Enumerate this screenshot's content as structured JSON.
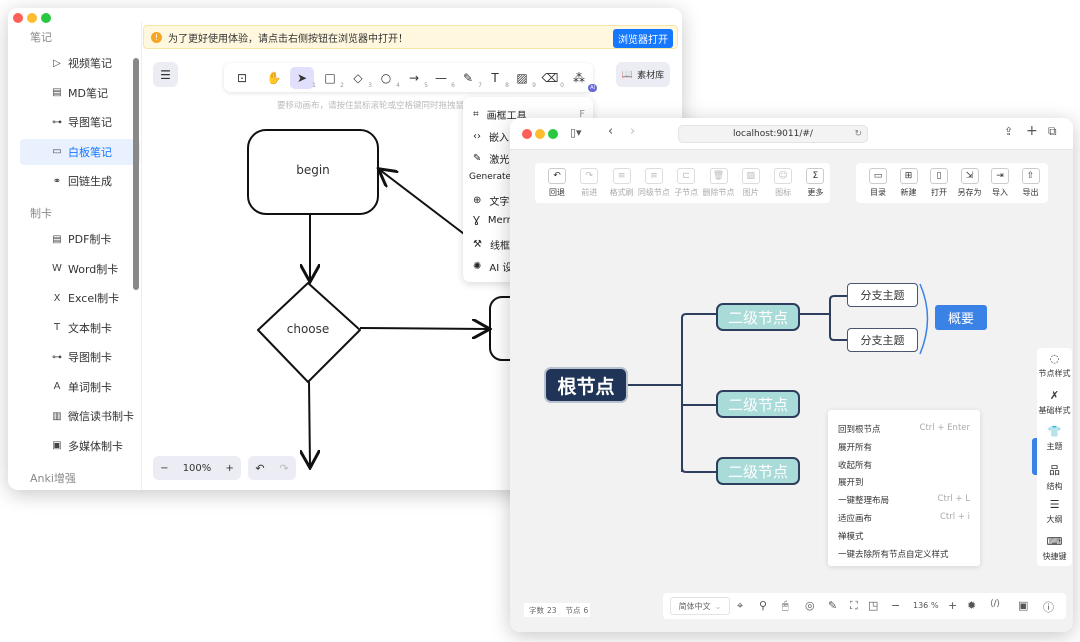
{
  "back_window": {
    "sidebar": {
      "sections": [
        {
          "title": "笔记",
          "items": [
            {
              "label": "视频笔记",
              "icon": "play-circle-icon"
            },
            {
              "label": "MD笔记",
              "icon": "markdown-file-icon"
            },
            {
              "label": "导图笔记",
              "icon": "mindmap-icon"
            },
            {
              "label": "白板笔记",
              "icon": "whiteboard-icon",
              "active": true
            },
            {
              "label": "回链生成",
              "icon": "link-icon"
            }
          ]
        },
        {
          "title": "制卡",
          "items": [
            {
              "label": "PDF制卡",
              "icon": "pdf-icon"
            },
            {
              "label": "Word制卡",
              "icon": "word-icon"
            },
            {
              "label": "Excel制卡",
              "icon": "excel-icon"
            },
            {
              "label": "文本制卡",
              "icon": "text-icon"
            },
            {
              "label": "导图制卡",
              "icon": "mindmap-icon"
            },
            {
              "label": "单词制卡",
              "icon": "letter-a-icon"
            },
            {
              "label": "微信读书制卡",
              "icon": "book-icon"
            },
            {
              "label": "多媒体制卡",
              "icon": "media-icon"
            }
          ]
        },
        {
          "title": "Anki增强",
          "items": []
        }
      ]
    },
    "banner": {
      "text": "为了更好使用体验，请点击右侧按钮在浏览器中打开！",
      "button": "浏览器打开"
    },
    "toolbar": {
      "tools": [
        {
          "icon": "lock-icon",
          "key": ""
        },
        {
          "icon": "hand-icon",
          "key": ""
        },
        {
          "icon": "pointer-icon",
          "key": "1",
          "active": true
        },
        {
          "icon": "rectangle-icon",
          "key": "2"
        },
        {
          "icon": "diamond-icon",
          "key": "3"
        },
        {
          "icon": "circle-icon",
          "key": "4"
        },
        {
          "icon": "arrow-icon",
          "key": "5"
        },
        {
          "icon": "line-icon",
          "key": "6"
        },
        {
          "icon": "pencil-icon",
          "key": "7"
        },
        {
          "icon": "text-icon",
          "key": "8"
        },
        {
          "icon": "image-icon",
          "key": "9"
        },
        {
          "icon": "eraser-icon",
          "key": "0"
        },
        {
          "icon": "shapes-icon",
          "key": "",
          "badge": "AI"
        }
      ],
      "library": "素材库",
      "hint": "要移动画布，请按住鼠标滚轮或空格键同时拖拽鼠标"
    },
    "dropdown": {
      "items": [
        {
          "label": "画框工具",
          "shortcut": "F",
          "icon": "frame-icon"
        },
        {
          "label": "嵌入",
          "icon": "embed-icon"
        },
        {
          "label": "激光",
          "icon": "laser-icon"
        }
      ],
      "section": "Generate",
      "gen_items": [
        {
          "label": "文字",
          "icon": "brain-icon"
        },
        {
          "label": "Merm",
          "icon": "mermaid-icon"
        },
        {
          "label": "线框",
          "icon": "wand-icon"
        },
        {
          "label": "AI 设",
          "icon": "openai-icon"
        }
      ]
    },
    "canvas": {
      "shapes": {
        "begin": "begin",
        "choose": "choose"
      }
    },
    "zoom": {
      "value": "100%",
      "minus": "−",
      "plus": "+"
    }
  },
  "front_window": {
    "url": "localhost:9011/#/",
    "toolbar_left": [
      {
        "label": "回退",
        "icon": "undo-icon",
        "enabled": true
      },
      {
        "label": "前进",
        "icon": "redo-icon"
      },
      {
        "label": "格式刷",
        "icon": "format-brush-icon"
      },
      {
        "label": "同级节点",
        "icon": "sibling-node-icon"
      },
      {
        "label": "子节点",
        "icon": "child-node-icon"
      },
      {
        "label": "删除节点",
        "icon": "trash-icon"
      },
      {
        "label": "图片",
        "icon": "image-icon"
      },
      {
        "label": "图标",
        "icon": "smiley-icon"
      },
      {
        "label": "更多",
        "icon": "formula-icon",
        "enabled": true
      }
    ],
    "toolbar_right": [
      {
        "label": "目录",
        "icon": "folder-icon"
      },
      {
        "label": "新建",
        "icon": "new-file-icon"
      },
      {
        "label": "打开",
        "icon": "file-icon"
      },
      {
        "label": "另存为",
        "icon": "save-as-icon"
      },
      {
        "label": "导入",
        "icon": "import-icon"
      },
      {
        "label": "导出",
        "icon": "export-icon"
      }
    ],
    "mindmap": {
      "root": "根节点",
      "level2": [
        "二级节点",
        "二级节点",
        "二级节点"
      ],
      "branches": [
        "分支主题",
        "分支主题"
      ],
      "summary": "概要"
    },
    "context_menu": [
      {
        "label": "回到根节点",
        "shortcut": "Ctrl + Enter"
      },
      {
        "label": "展开所有",
        "shortcut": ""
      },
      {
        "label": "收起所有",
        "shortcut": ""
      },
      {
        "label": "展开到",
        "shortcut": ""
      },
      {
        "label": "一键整理布局",
        "shortcut": "Ctrl + L"
      },
      {
        "label": "适应画布",
        "shortcut": "Ctrl + i"
      },
      {
        "label": "禅模式",
        "shortcut": ""
      },
      {
        "label": "一键去除所有节点自定义样式",
        "shortcut": ""
      }
    ],
    "right_panel": [
      {
        "label": "节点样式",
        "icon": "paint-icon"
      },
      {
        "label": "基础样式",
        "icon": "magic-icon"
      },
      {
        "label": "主题",
        "icon": "shirt-icon"
      },
      {
        "label": "结构",
        "icon": "structure-icon"
      },
      {
        "label": "大纲",
        "icon": "outline-icon"
      },
      {
        "label": "快捷键",
        "icon": "keyboard-icon"
      }
    ],
    "status": {
      "words_label": "字数",
      "words": "23",
      "nodes_label": "节点",
      "nodes": "6"
    },
    "bottom": {
      "language": "简体中文",
      "zoom": "136",
      "percent": "%"
    },
    "colors": {
      "root": "#1f3456",
      "level2": "#a9dbd9",
      "summary": "#3b82e6",
      "accent": "#1677ff"
    }
  }
}
